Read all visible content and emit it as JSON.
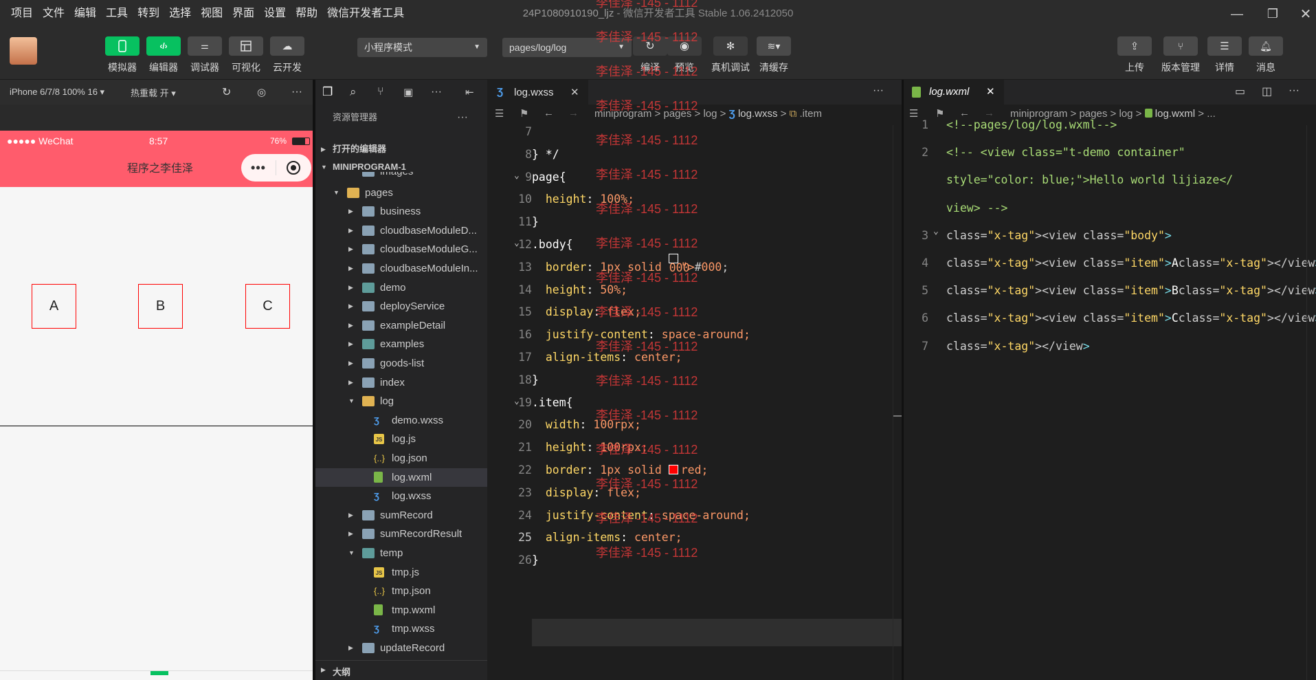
{
  "menu": [
    "项目",
    "文件",
    "编辑",
    "工具",
    "转到",
    "选择",
    "视图",
    "界面",
    "设置",
    "帮助",
    "微信开发者工具"
  ],
  "window": {
    "project": "24P1080910190_ljz",
    "app": "- 微信开发者工具 Stable 1.06.2412050"
  },
  "toolbar": {
    "simulator": "模拟器",
    "editor": "编辑器",
    "debugger": "调试器",
    "visual": "可视化",
    "cloud": "云开发",
    "mode": "小程序模式",
    "page_path": "pages/log/log",
    "compile": "编译",
    "preview": "预览",
    "remote_debug": "真机调试",
    "clear_cache": "清缓存",
    "upload": "上传",
    "version": "版本管理",
    "details": "详情",
    "messages": "消息"
  },
  "simulator": {
    "device": "iPhone 6/7/8 100% 16 ▾",
    "hot_reload": "热重载 开 ▾",
    "status": {
      "carrier": "●●●●● WeChat",
      "time": "8:57",
      "battery": "76%"
    },
    "nav_title": "程序之李佳泽",
    "items": [
      "A",
      "B",
      "C"
    ]
  },
  "explorer": {
    "header": "资源管理器",
    "open_editors": "打开的编辑器",
    "project": "MINIPROGRAM-1",
    "outline": "大纲",
    "rows": [
      {
        "label": "images",
        "type": "folder",
        "indent": 2,
        "arrow": ""
      },
      {
        "label": "pages",
        "type": "folder-open",
        "indent": 1,
        "arrow": "▼"
      },
      {
        "label": "business",
        "type": "folder",
        "indent": 2,
        "arrow": "▶"
      },
      {
        "label": "cloudbaseModuleD...",
        "type": "folder",
        "indent": 2,
        "arrow": "▶"
      },
      {
        "label": "cloudbaseModuleG...",
        "type": "folder",
        "indent": 2,
        "arrow": "▶"
      },
      {
        "label": "cloudbaseModuleIn...",
        "type": "folder",
        "indent": 2,
        "arrow": "▶"
      },
      {
        "label": "demo",
        "type": "folder-teal",
        "indent": 2,
        "arrow": "▶"
      },
      {
        "label": "deployService",
        "type": "folder",
        "indent": 2,
        "arrow": "▶"
      },
      {
        "label": "exampleDetail",
        "type": "folder",
        "indent": 2,
        "arrow": "▶"
      },
      {
        "label": "examples",
        "type": "folder-teal",
        "indent": 2,
        "arrow": "▶"
      },
      {
        "label": "goods-list",
        "type": "folder",
        "indent": 2,
        "arrow": "▶"
      },
      {
        "label": "index",
        "type": "folder",
        "indent": 2,
        "arrow": "▶"
      },
      {
        "label": "log",
        "type": "folder-open",
        "indent": 2,
        "arrow": "▼"
      },
      {
        "label": "demo.wxss",
        "type": "css",
        "indent": 3,
        "arrow": ""
      },
      {
        "label": "log.js",
        "type": "js",
        "indent": 3,
        "arrow": ""
      },
      {
        "label": "log.json",
        "type": "json",
        "indent": 3,
        "arrow": ""
      },
      {
        "label": "log.wxml",
        "type": "wxml",
        "indent": 3,
        "arrow": ""
      },
      {
        "label": "log.wxss",
        "type": "css",
        "indent": 3,
        "arrow": ""
      },
      {
        "label": "sumRecord",
        "type": "folder",
        "indent": 2,
        "arrow": "▶"
      },
      {
        "label": "sumRecordResult",
        "type": "folder",
        "indent": 2,
        "arrow": "▶"
      },
      {
        "label": "temp",
        "type": "folder-teal",
        "indent": 2,
        "arrow": "▼"
      },
      {
        "label": "tmp.js",
        "type": "js",
        "indent": 3,
        "arrow": ""
      },
      {
        "label": "tmp.json",
        "type": "json",
        "indent": 3,
        "arrow": ""
      },
      {
        "label": "tmp.wxml",
        "type": "wxml",
        "indent": 3,
        "arrow": ""
      },
      {
        "label": "tmp.wxss",
        "type": "css",
        "indent": 3,
        "arrow": ""
      },
      {
        "label": "updateRecord",
        "type": "folder",
        "indent": 2,
        "arrow": "▶"
      }
    ]
  },
  "editor1": {
    "tab": "log.wxss",
    "crumbs": [
      "miniprogram",
      "pages",
      "log",
      "log.wxss",
      ".item"
    ],
    "lines": [
      {
        "n": "7",
        "t": ""
      },
      {
        "n": "8",
        "t": "} */"
      },
      {
        "n": "9",
        "t": "page{"
      },
      {
        "n": "10",
        "t": "  height: 100%;"
      },
      {
        "n": "11",
        "t": "}"
      },
      {
        "n": "12",
        "t": ".body{"
      },
      {
        "n": "13",
        "t": "  border: 1px solid #000;"
      },
      {
        "n": "14",
        "t": "  height: 50%;"
      },
      {
        "n": "15",
        "t": "  display: flex;"
      },
      {
        "n": "16",
        "t": "  justify-content: space-around;"
      },
      {
        "n": "17",
        "t": "  align-items: center;"
      },
      {
        "n": "18",
        "t": "}"
      },
      {
        "n": "19",
        "t": ".item{"
      },
      {
        "n": "20",
        "t": "  width: 100rpx;"
      },
      {
        "n": "21",
        "t": "  height: 100rpx;"
      },
      {
        "n": "22",
        "t": "  border: 1px solid red;"
      },
      {
        "n": "23",
        "t": "  display: flex;"
      },
      {
        "n": "24",
        "t": "  justify-content: space-around;"
      },
      {
        "n": "25",
        "t": "  align-items: center;"
      },
      {
        "n": "26",
        "t": "}"
      }
    ],
    "watermark": "李佳泽 -145 - 1112"
  },
  "editor2": {
    "tab": "log.wxml",
    "crumbs": [
      "miniprogram",
      "pages",
      "log",
      "log.wxml",
      "..."
    ],
    "lines": [
      {
        "n": "1",
        "t": "<!--pages/log/log.wxml-->"
      },
      {
        "n": "2",
        "t": "<!-- <view class=\"t-demo container\""
      },
      {
        "n": "",
        "t": "style=\"color: blue;\">Hello world lijiaze</"
      },
      {
        "n": "",
        "t": "view> -->"
      },
      {
        "n": "3",
        "t": "<view class=\"body\">"
      },
      {
        "n": "4",
        "t": "<view class=\"item\">A</view>"
      },
      {
        "n": "5",
        "t": "<view class=\"item\">B</view>"
      },
      {
        "n": "6",
        "t": "<view class=\"item\">C</view>"
      },
      {
        "n": "7",
        "t": "</view>"
      }
    ]
  }
}
